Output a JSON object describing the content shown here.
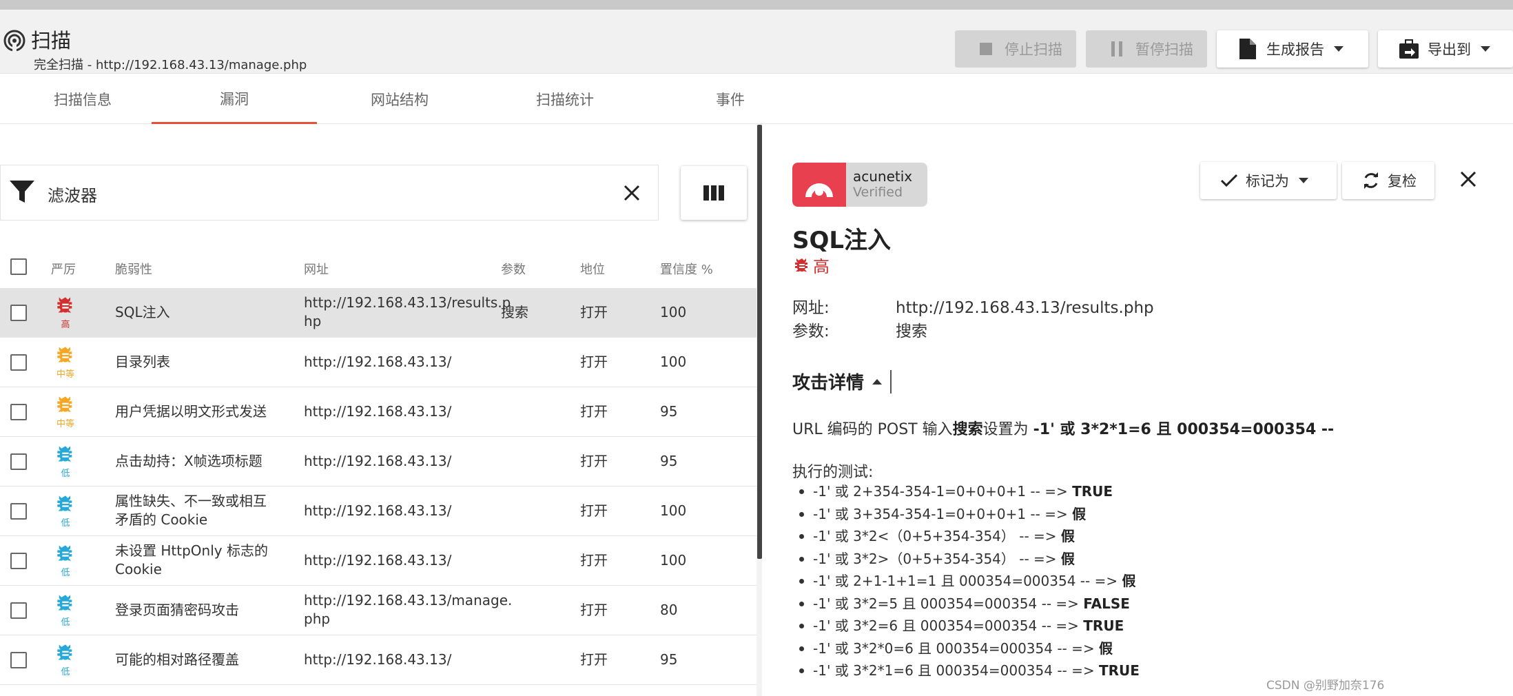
{
  "header": {
    "title": "扫描",
    "subtitle": "完全扫描 - http://192.168.43.13/manage.php",
    "buttons": {
      "stop": "停止扫描",
      "pause": "暂停扫描",
      "report": "生成报告",
      "export": "导出到"
    }
  },
  "tabs": [
    "扫描信息",
    "漏洞",
    "网站结构",
    "扫描统计",
    "事件"
  ],
  "active_tab": "漏洞",
  "filter": {
    "label": "滤波器"
  },
  "table": {
    "columns": [
      "严厉",
      "脆弱性",
      "网址",
      "参数",
      "地位",
      "置信度 %"
    ],
    "rows": [
      {
        "severity": "高",
        "severity_color": "#d32f2f",
        "vuln_l1": "SQL注入",
        "vuln_l2": "",
        "url_l1": "http://192.168.43.13/results.p",
        "url_l2": "hp",
        "param": "搜索",
        "status": "打开",
        "confidence": "100"
      },
      {
        "severity": "中等",
        "severity_color": "#f5a623",
        "vuln_l1": "目录列表",
        "vuln_l2": "",
        "url_l1": "http://192.168.43.13/",
        "url_l2": "",
        "param": "",
        "status": "打开",
        "confidence": "100"
      },
      {
        "severity": "中等",
        "severity_color": "#f5a623",
        "vuln_l1": "用户凭据以明文形式发送",
        "vuln_l2": "",
        "url_l1": "http://192.168.43.13/",
        "url_l2": "",
        "param": "",
        "status": "打开",
        "confidence": "95"
      },
      {
        "severity": "低",
        "severity_color": "#26a9d8",
        "vuln_l1": "点击劫持：X帧选项标题",
        "vuln_l2": "",
        "url_l1": "http://192.168.43.13/",
        "url_l2": "",
        "param": "",
        "status": "打开",
        "confidence": "95"
      },
      {
        "severity": "低",
        "severity_color": "#26a9d8",
        "vuln_l1": "属性缺失、不一致或相互",
        "vuln_l2": "矛盾的 Cookie",
        "url_l1": "http://192.168.43.13/",
        "url_l2": "",
        "param": "",
        "status": "打开",
        "confidence": "100"
      },
      {
        "severity": "低",
        "severity_color": "#26a9d8",
        "vuln_l1": "未设置 HttpOnly 标志的",
        "vuln_l2": "Cookie",
        "url_l1": "http://192.168.43.13/",
        "url_l2": "",
        "param": "",
        "status": "打开",
        "confidence": "100"
      },
      {
        "severity": "低",
        "severity_color": "#26a9d8",
        "vuln_l1": "登录页面猜密码攻击",
        "vuln_l2": "",
        "url_l1": "http://192.168.43.13/manage.",
        "url_l2": "php",
        "param": "",
        "status": "打开",
        "confidence": "80"
      },
      {
        "severity": "低",
        "severity_color": "#26a9d8",
        "vuln_l1": "可能的相对路径覆盖",
        "vuln_l2": "",
        "url_l1": "http://192.168.43.13/",
        "url_l2": "",
        "param": "",
        "status": "打开",
        "confidence": "95"
      }
    ]
  },
  "detail": {
    "logo": {
      "brand": "acunetix",
      "verified": "Verified"
    },
    "mark_button": "标记为",
    "recheck_button": "复检",
    "title": "SQL注入",
    "severity": "高",
    "url_label": "网址:",
    "url_value": "http://192.168.43.13/results.php",
    "param_label": "参数:",
    "param_value": "搜索",
    "attack_section": "攻击详情",
    "attack_pre": "URL 编码的 POST 输入",
    "attack_field": "搜索",
    "attack_mid": "设置为",
    "attack_payload": "-1' 或 3*2*1=6 且 000354=000354 --",
    "tests_title": "执行的测试:",
    "tests": [
      {
        "expr": "-1' 或 2+354-354-1=0+0+0+1 -- => ",
        "result": "TRUE"
      },
      {
        "expr": "-1' 或 3+354-354-1=0+0+0+1 -- => ",
        "result": "假"
      },
      {
        "expr": "-1' 或 3*2<（0+5+354-354） -- => ",
        "result": "假"
      },
      {
        "expr": "-1' 或 3*2>（0+5+354-354） -- => ",
        "result": "假"
      },
      {
        "expr": "-1' 或 2+1-1+1=1 且 000354=000354 -- => ",
        "result": "假"
      },
      {
        "expr": "-1' 或 3*2=5 且 000354=000354 -- => ",
        "result": "FALSE"
      },
      {
        "expr": "-1' 或 3*2=6 且 000354=000354 -- => ",
        "result": "TRUE"
      },
      {
        "expr": "-1' 或 3*2*0=6 且 000354=000354 -- => ",
        "result": "假"
      },
      {
        "expr": "-1' 或 3*2*1=6 且 000354=000354 -- => ",
        "result": "TRUE"
      }
    ]
  },
  "watermark": "CSDN @别野加奈176"
}
